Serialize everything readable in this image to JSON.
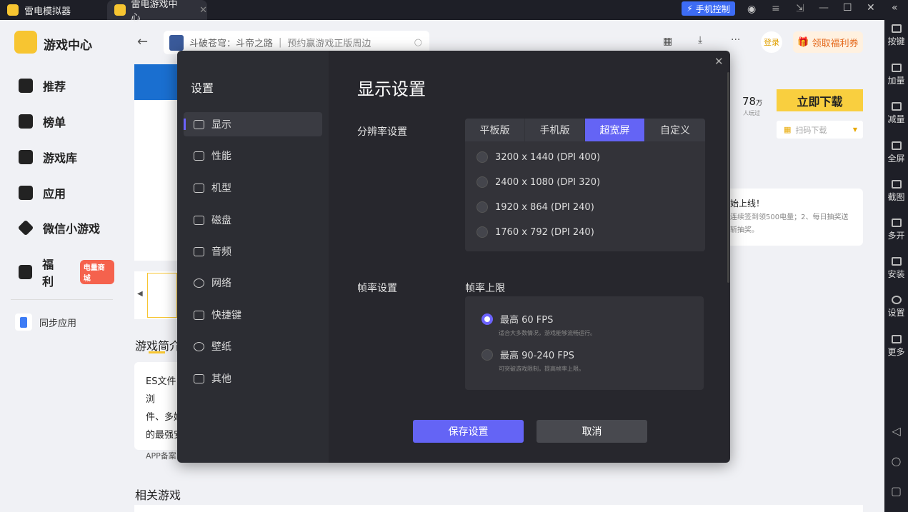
{
  "titlebar": {
    "tabs": [
      {
        "label": "雷电模拟器"
      },
      {
        "label": "雷电游戏中心"
      }
    ],
    "phone_control": "手机控制"
  },
  "right_toolbar": [
    {
      "label": "按键"
    },
    {
      "label": "加量"
    },
    {
      "label": "减量"
    },
    {
      "label": "全屏"
    },
    {
      "label": "截图"
    },
    {
      "label": "多开"
    },
    {
      "label": "安装"
    },
    {
      "label": "设置"
    },
    {
      "label": "更多"
    }
  ],
  "sidebar": {
    "title": "游戏中心",
    "items": [
      {
        "label": "推荐"
      },
      {
        "label": "榜单"
      },
      {
        "label": "游戏库"
      },
      {
        "label": "应用"
      },
      {
        "label": "微信小游戏"
      },
      {
        "label": "福利",
        "badge": "电量商城"
      }
    ],
    "sync": "同步应用"
  },
  "header": {
    "search_game": "斗破苍穹：斗帝之路",
    "search_hint": "预约赢游戏正版周边",
    "login": "登录",
    "coupon": "领取福利券"
  },
  "game": {
    "players": "78",
    "players_unit": "万",
    "players_label": "人玩过",
    "download": "立即下载",
    "qr_download": "扫码下载",
    "intro_title": "游戏简介",
    "intro_lines": [
      "ES文件浏",
      "件、多媒",
      "的最强安"
    ],
    "app_record": "APP备案",
    "related": "相关游戏",
    "notice_title": "始上线！",
    "notice_lines": [
      "连续签到领500电量；2、每日抽奖送",
      "斩抽奖。"
    ]
  },
  "settings": {
    "title": "设置",
    "menu": [
      {
        "label": "显示"
      },
      {
        "label": "性能"
      },
      {
        "label": "机型"
      },
      {
        "label": "磁盘"
      },
      {
        "label": "音频"
      },
      {
        "label": "网络"
      },
      {
        "label": "快捷键"
      },
      {
        "label": "壁纸"
      },
      {
        "label": "其他"
      }
    ],
    "heading": "显示设置",
    "resolution_label": "分辨率设置",
    "resolution_tabs": [
      {
        "label": "平板版"
      },
      {
        "label": "手机版"
      },
      {
        "label": "超宽屏"
      },
      {
        "label": "自定义"
      }
    ],
    "resolutions": [
      {
        "label": "3200 x 1440  (DPI 400)"
      },
      {
        "label": "2400 x 1080  (DPI 320)"
      },
      {
        "label": "1920 x 864  (DPI 240)"
      },
      {
        "label": "1760 x 792  (DPI 240)"
      }
    ],
    "fps_label": "帧率设置",
    "fps_sub": "帧率上限",
    "fps_options": [
      {
        "label": "最高 60 FPS",
        "desc": "适合大多数情况，游戏能够流畅运行。"
      },
      {
        "label": "最高 90-240 FPS",
        "desc": "可突破游戏限制，提高帧率上限。"
      }
    ],
    "save": "保存设置",
    "cancel": "取消"
  }
}
